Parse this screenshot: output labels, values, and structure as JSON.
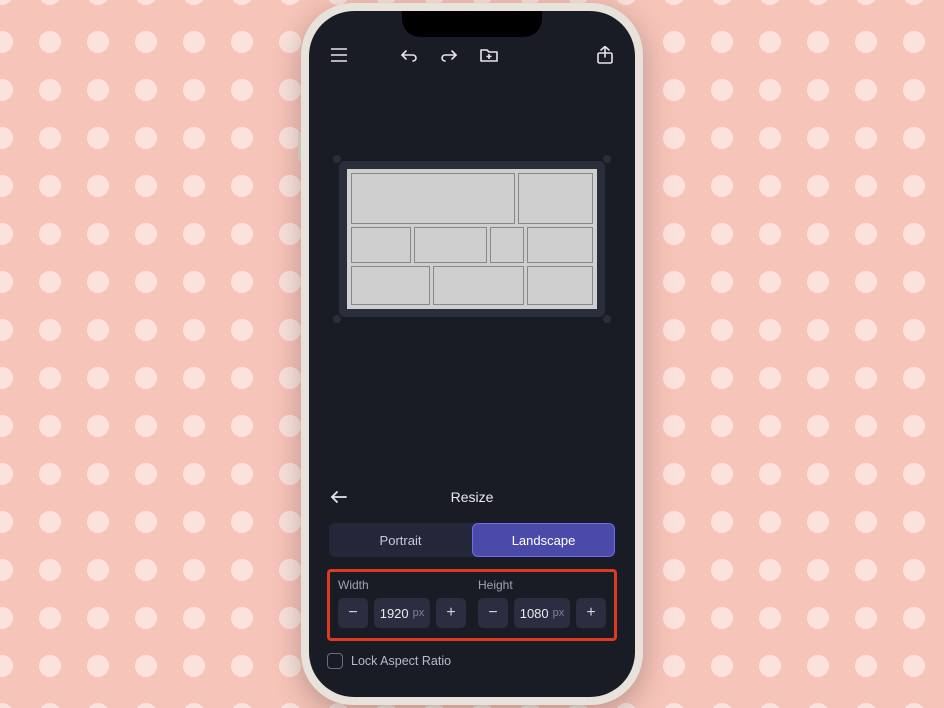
{
  "panel": {
    "title": "Resize",
    "tabs": {
      "portrait": "Portrait",
      "landscape": "Landscape",
      "active": "landscape"
    },
    "width_label": "Width",
    "height_label": "Height",
    "width_value": "1920",
    "height_value": "1080",
    "unit": "px",
    "lock_label": "Lock Aspect Ratio",
    "lock_checked": false
  },
  "icons": {
    "menu": "menu-icon",
    "undo": "undo-icon",
    "redo": "redo-icon",
    "folder": "folder-icon",
    "share": "share-icon",
    "back": "back-icon"
  },
  "colors": {
    "accent": "#4b4aa8",
    "highlight_border": "#dd3b1f",
    "bg_dark": "#1a1c25"
  }
}
